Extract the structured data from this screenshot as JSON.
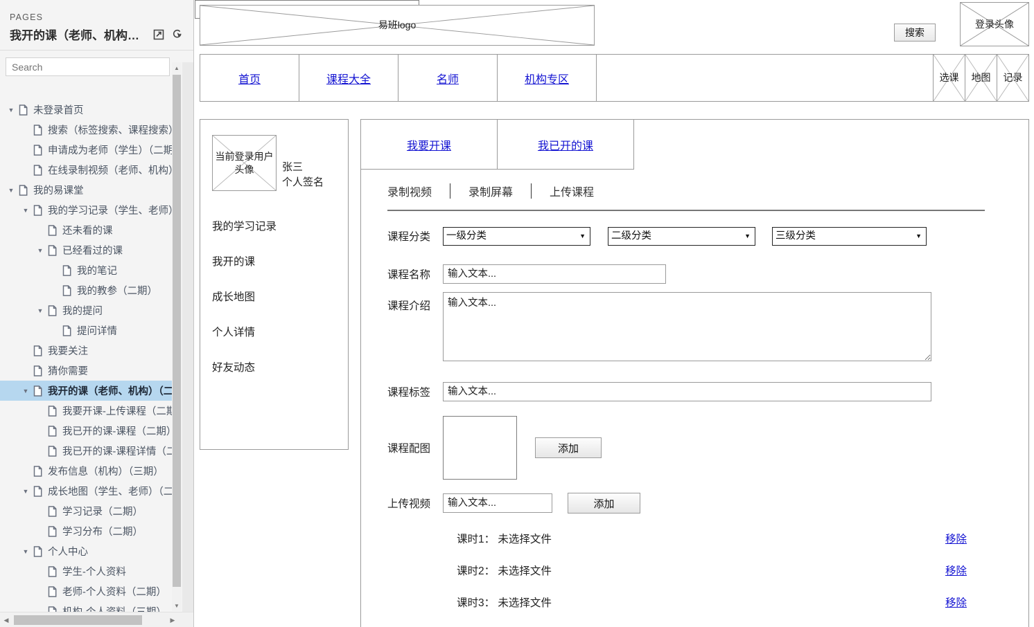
{
  "sidebar": {
    "eyebrow": "PAGES",
    "title": "我开的课（老师、机构…",
    "icons": {
      "export": "export-icon",
      "preview": "preview-cursor-icon"
    },
    "search_placeholder": "Search",
    "tree": [
      {
        "depth": 0,
        "twisty": "▼",
        "label": "未登录首页",
        "selected": false
      },
      {
        "depth": 1,
        "twisty": "",
        "label": "搜索（标签搜索、课程搜索）",
        "selected": false
      },
      {
        "depth": 1,
        "twisty": "",
        "label": "申请成为老师（学生）（二期）",
        "selected": false
      },
      {
        "depth": 1,
        "twisty": "",
        "label": "在线录制视频（老师、机构）",
        "selected": false
      },
      {
        "depth": 0,
        "twisty": "▼",
        "label": "我的易课堂",
        "selected": false
      },
      {
        "depth": 1,
        "twisty": "▼",
        "label": "我的学习记录（学生、老师）",
        "selected": false
      },
      {
        "depth": 2,
        "twisty": "",
        "label": "还未看的课",
        "selected": false
      },
      {
        "depth": 2,
        "twisty": "▼",
        "label": "已经看过的课",
        "selected": false
      },
      {
        "depth": 3,
        "twisty": "",
        "label": "我的笔记",
        "selected": false
      },
      {
        "depth": 3,
        "twisty": "",
        "label": "我的教参（二期）",
        "selected": false
      },
      {
        "depth": 2,
        "twisty": "▼",
        "label": "我的提问",
        "selected": false
      },
      {
        "depth": 3,
        "twisty": "",
        "label": "提问详情",
        "selected": false
      },
      {
        "depth": 1,
        "twisty": "",
        "label": "我要关注",
        "selected": false
      },
      {
        "depth": 1,
        "twisty": "",
        "label": "猜你需要",
        "selected": false
      },
      {
        "depth": 1,
        "twisty": "▼",
        "label": "我开的课（老师、机构）（二期）",
        "selected": true
      },
      {
        "depth": 2,
        "twisty": "",
        "label": "我要开课-上传课程（二期）",
        "selected": false
      },
      {
        "depth": 2,
        "twisty": "",
        "label": "我已开的课-课程（二期）",
        "selected": false
      },
      {
        "depth": 2,
        "twisty": "",
        "label": "我已开的课-课程详情（二期）",
        "selected": false
      },
      {
        "depth": 1,
        "twisty": "",
        "label": "发布信息（机构）（三期）",
        "selected": false
      },
      {
        "depth": 1,
        "twisty": "▼",
        "label": "成长地图（学生、老师）（二期）",
        "selected": false
      },
      {
        "depth": 2,
        "twisty": "",
        "label": "学习记录（二期）",
        "selected": false
      },
      {
        "depth": 2,
        "twisty": "",
        "label": "学习分布（二期）",
        "selected": false
      },
      {
        "depth": 1,
        "twisty": "▼",
        "label": "个人中心",
        "selected": false
      },
      {
        "depth": 2,
        "twisty": "",
        "label": "学生-个人资料",
        "selected": false
      },
      {
        "depth": 2,
        "twisty": "",
        "label": "老师-个人资料（二期）",
        "selected": false
      },
      {
        "depth": 2,
        "twisty": "",
        "label": "机构-个人资料（三期）",
        "selected": false
      }
    ]
  },
  "header": {
    "logo_label": "易班logo",
    "search_value": "",
    "search_button": "搜索",
    "avatar_label": "登录头像"
  },
  "nav": {
    "items": [
      {
        "label": "首页"
      },
      {
        "label": "课程大全"
      },
      {
        "label": "名师"
      },
      {
        "label": "机构专区"
      }
    ],
    "icons": [
      {
        "label": "选课"
      },
      {
        "label": "地图"
      },
      {
        "label": "记录"
      }
    ]
  },
  "user_panel": {
    "avatar_label": "当前登录用户头像",
    "name": "张三",
    "signature": "个人签名",
    "menu": [
      {
        "label": "我的学习记录"
      },
      {
        "label": "我开的课"
      },
      {
        "label": "成长地图"
      },
      {
        "label": "个人详情"
      },
      {
        "label": "好友动态"
      }
    ]
  },
  "main": {
    "tabs": [
      {
        "label": "我要开课"
      },
      {
        "label": "我已开的课"
      }
    ],
    "subtabs": [
      {
        "label": "录制视频"
      },
      {
        "label": "录制屏幕"
      },
      {
        "label": "上传课程"
      }
    ],
    "form": {
      "category_label": "课程分类",
      "category_level1": "一级分类",
      "category_level2": "二级分类",
      "category_level3": "三级分类",
      "name_label": "课程名称",
      "name_placeholder": "输入文本...",
      "intro_label": "课程介绍",
      "intro_placeholder": "输入文本...",
      "tag_label": "课程标签",
      "tag_placeholder": "输入文本...",
      "image_label": "课程配图",
      "image_add_button": "添加",
      "video_label": "上传视频",
      "video_placeholder": "输入文本...",
      "video_add_button": "添加"
    },
    "lessons": [
      {
        "name": "课时1： 未选择文件",
        "remove": "移除"
      },
      {
        "name": "课时2： 未选择文件",
        "remove": "移除"
      },
      {
        "name": "课时3： 未选择文件",
        "remove": "移除"
      }
    ]
  },
  "colors": {
    "link": "#1414d2",
    "selection": "#b6d7ef",
    "wireframe_border": "#9a9a9a"
  }
}
